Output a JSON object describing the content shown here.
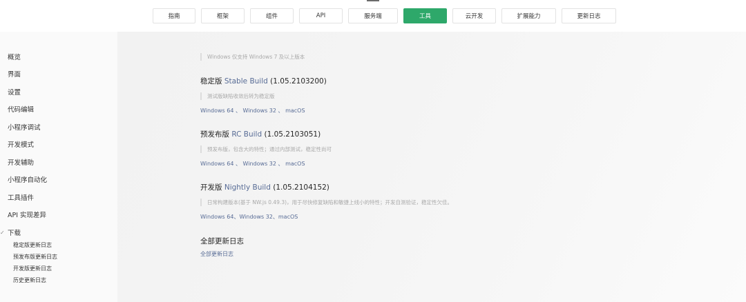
{
  "nav": {
    "tabs": [
      "指南",
      "框架",
      "组件",
      "API",
      "服务端",
      "工具",
      "云开发",
      "扩展能力",
      "更新日志"
    ],
    "active_index": 5
  },
  "sidebar": {
    "items": [
      "概览",
      "界面",
      "设置",
      "代码编辑",
      "小程序调试",
      "开发模式",
      "开发辅助",
      "小程序自动化",
      "工具插件",
      "API 实现差异",
      "下载"
    ],
    "download_children": [
      "稳定版更新日志",
      "预发布版更新日志",
      "开发版更新日志",
      "历史更新日志"
    ],
    "expanded_icon": "chevron-down-icon"
  },
  "content": {
    "windows_note": "Windows 仅支持 Windows 7 及以上版本",
    "stable": {
      "prefix": "稳定版 ",
      "link": "Stable Build",
      "version": " (1.05.2103200)",
      "note": "测试版缺陷收敛后转为稳定版",
      "downloads": [
        "Windows 64",
        "Windows 32",
        "macOS"
      ],
      "separator": " 、 "
    },
    "rc": {
      "prefix": "预发布版 ",
      "link": "RC Build",
      "version": " (1.05.2103051)",
      "note": "预发布版，包含大的特性；通过内部测试，稳定性尚可",
      "downloads": [
        "Windows 64",
        "Windows 32",
        "macOS"
      ],
      "separator": " 、 "
    },
    "nightly": {
      "prefix": "开发版 ",
      "link": "Nightly Build",
      "version": " (1.05.2104152)",
      "note": "日常构建版本(基于 NW.js 0.49.3)，用于尽快修复缺陷和敏捷上线小的特性；开发自测验证，稳定性欠佳。",
      "downloads": [
        "Windows 64",
        "Windows 32",
        "macOS"
      ],
      "separator": "、"
    },
    "all_logs": {
      "title": "全部更新日志",
      "link": "全部更新日志"
    }
  },
  "colors": {
    "accent_green": "#2ea86a",
    "link_blue": "#576b95"
  }
}
